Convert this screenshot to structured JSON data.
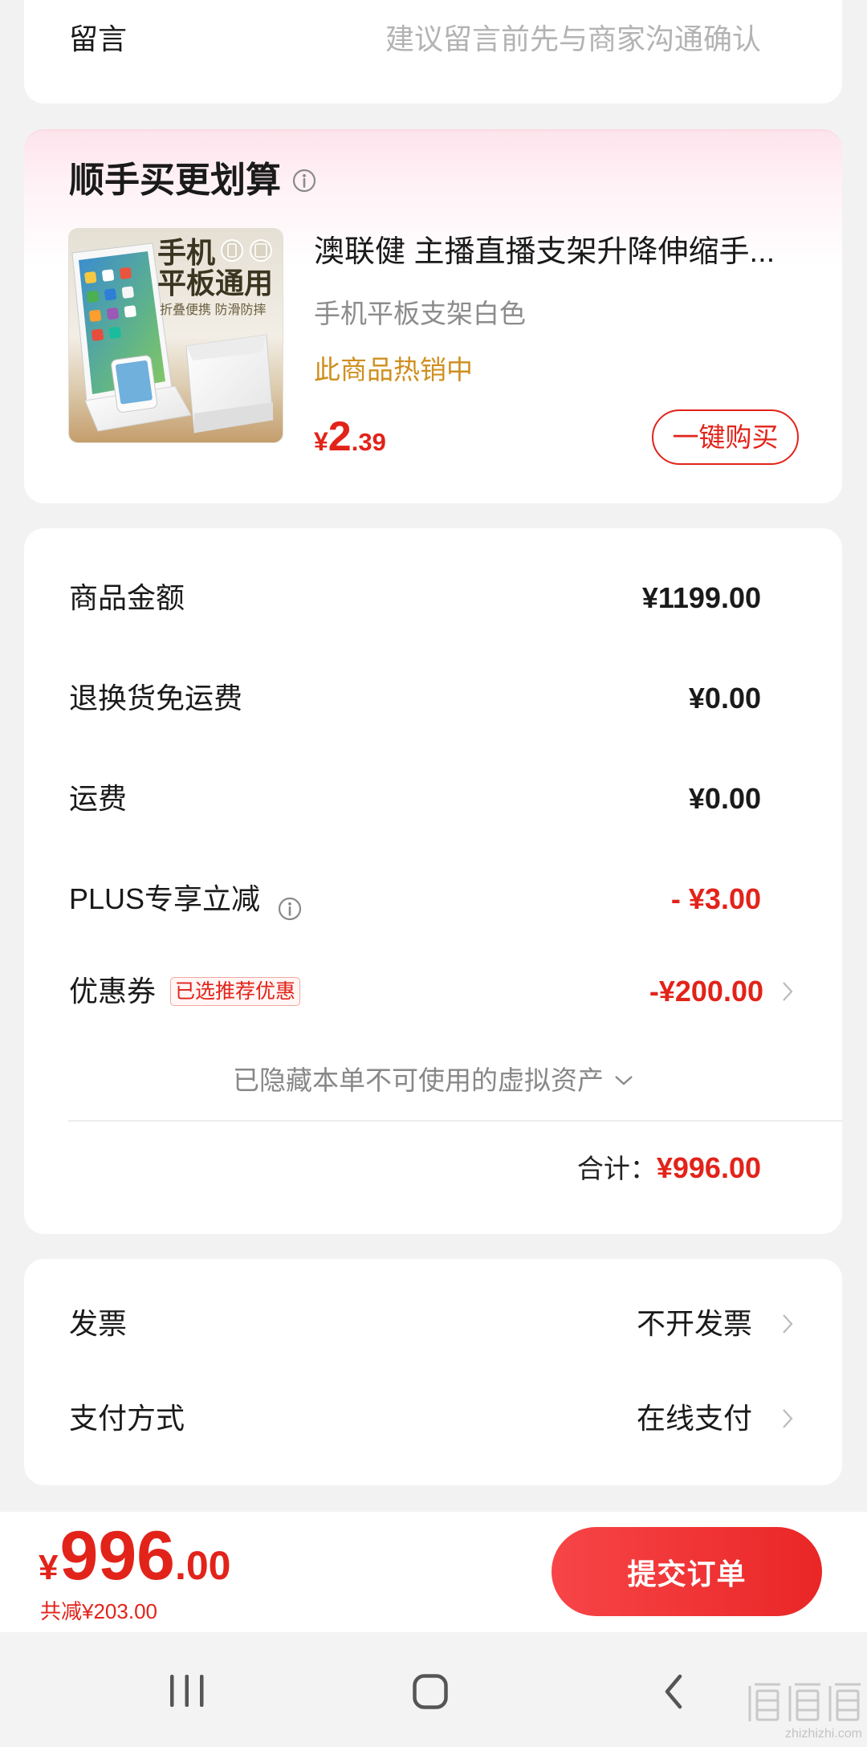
{
  "remark": {
    "label": "留言",
    "placeholder": "建议留言前先与商家沟通确认"
  },
  "addon": {
    "title": "顺手买更划算",
    "product": {
      "image_text": {
        "line1": "手机",
        "line2": "平板通用",
        "line3": "折叠便携 防滑防摔"
      },
      "title": "澳联健 主播直播支架升降伸缩手...",
      "spec": "手机平板支架白色",
      "hot_label": "此商品热销中",
      "price": {
        "currency": "¥",
        "integer": "2",
        "decimal": ".39"
      },
      "buy_button": "一键购买"
    }
  },
  "summary": {
    "goods_amount": {
      "label": "商品金额",
      "value": "¥1199.00"
    },
    "return_shipping": {
      "label": "退换货免运费",
      "value": "¥0.00"
    },
    "shipping": {
      "label": "运费",
      "value": "¥0.00"
    },
    "plus_discount": {
      "label": "PLUS专享立减",
      "value": "- ¥3.00"
    },
    "coupon": {
      "label": "优惠券",
      "badge": "已选推荐优惠",
      "value": "-¥200.00"
    },
    "hidden_assets": "已隐藏本单不可使用的虚拟资产",
    "total": {
      "label": "合计：",
      "value": "¥996.00"
    }
  },
  "options": {
    "invoice": {
      "label": "发票",
      "value": "不开发票"
    },
    "payment": {
      "label": "支付方式",
      "value": "在线支付"
    }
  },
  "bottom_bar": {
    "total": {
      "currency": "¥",
      "integer": "996",
      "decimal": ".00"
    },
    "saved": "共减¥203.00",
    "submit_button": "提交订单"
  },
  "icons": {
    "info": "info-icon",
    "row_arrow": "chevron-right-icon",
    "expand": "chevron-down-icon",
    "nav": [
      "recent-apps-icon",
      "home-icon",
      "back-icon"
    ]
  },
  "watermark": {
    "text": "zhizhizhi.com"
  },
  "colors": {
    "accent_red": "#e2231a",
    "hot_gold": "#cf8f1f",
    "page_background": "#f2f2f2",
    "secondary_text": "#8c8c8c"
  }
}
